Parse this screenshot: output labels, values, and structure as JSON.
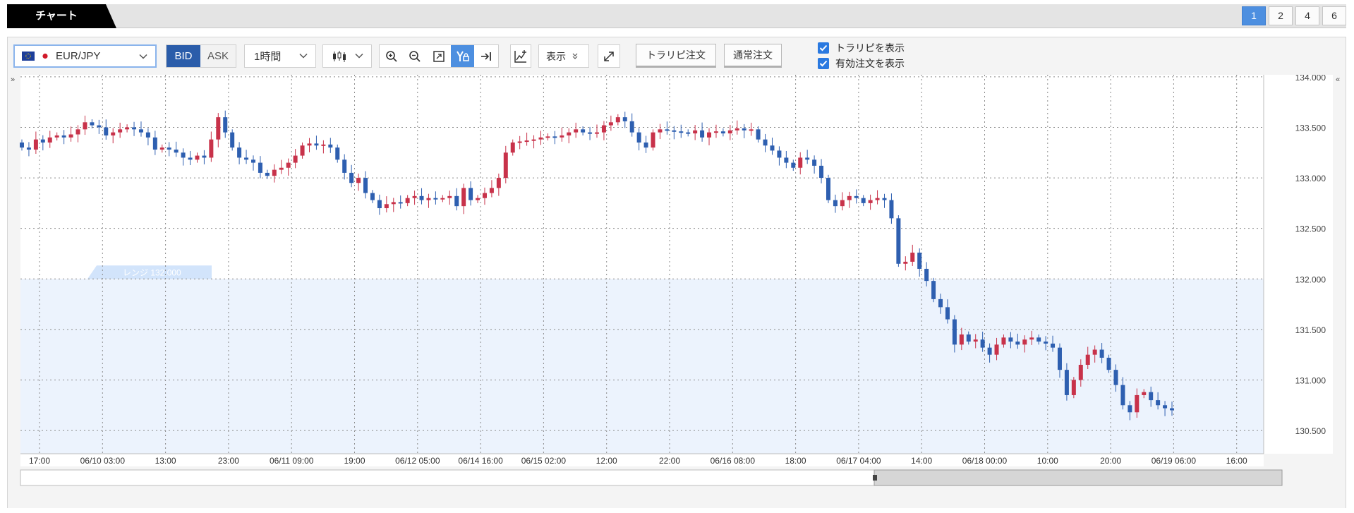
{
  "tab": {
    "label": "チャート"
  },
  "layout_buttons": [
    "1",
    "2",
    "4",
    "6"
  ],
  "toolbar": {
    "symbol": "EUR/JPY",
    "bid": "BID",
    "ask": "ASK",
    "period": "1時間",
    "display": "表示",
    "trailing_order": "トラリピ注文",
    "normal_order": "通常注文",
    "show_trailing": "トラリピを表示",
    "show_active_orders": "有効注文を表示"
  },
  "colors": {
    "up": "#c8324a",
    "down": "#2e5fb0",
    "range_fill": "#ecf3fd",
    "accent": "#4d8fe0"
  },
  "chart_data": {
    "type": "candlestick",
    "symbol": "EUR/JPY",
    "timeframe": "1時間",
    "y_ticks": [
      "134.000",
      "133.500",
      "133.000",
      "132.500",
      "132.000",
      "131.500",
      "131.000",
      "130.500"
    ],
    "ylim": [
      130.27,
      134.02
    ],
    "x_ticks": [
      "17:00",
      "06/10 03:00",
      "13:00",
      "23:00",
      "06/11 09:00",
      "19:00",
      "06/12 05:00",
      "06/14 16:00",
      "06/15 02:00",
      "12:00",
      "22:00",
      "06/16 08:00",
      "18:00",
      "06/17 04:00",
      "14:00",
      "06/18 00:00",
      "10:00",
      "20:00",
      "06/19 06:00",
      "16:00"
    ],
    "range_band": {
      "label": "レンジ 132.000",
      "from": 130.27,
      "to": 132.0
    },
    "close": [
      133.3,
      133.28,
      133.38,
      133.35,
      133.4,
      133.42,
      133.4,
      133.43,
      133.48,
      133.55,
      133.52,
      133.5,
      133.42,
      133.45,
      133.48,
      133.5,
      133.48,
      133.45,
      133.4,
      133.28,
      133.3,
      133.28,
      133.25,
      133.2,
      133.18,
      133.22,
      133.2,
      133.38,
      133.6,
      133.45,
      133.3,
      133.2,
      133.18,
      133.15,
      133.05,
      133.02,
      133.08,
      133.1,
      133.15,
      133.22,
      133.32,
      133.34,
      133.32,
      133.33,
      133.3,
      133.18,
      133.05,
      132.95,
      133.0,
      132.85,
      132.78,
      132.7,
      132.74,
      132.76,
      132.75,
      132.8,
      132.82,
      132.78,
      132.8,
      132.79,
      132.8,
      132.82,
      132.72,
      132.9,
      132.78,
      132.8,
      132.85,
      132.9,
      133.0,
      133.25,
      133.35,
      133.36,
      133.37,
      133.38,
      133.4,
      133.41,
      133.4,
      133.42,
      133.45,
      133.48,
      133.45,
      133.44,
      133.45,
      133.52,
      133.55,
      133.6,
      133.56,
      133.45,
      133.35,
      133.3,
      133.45,
      133.48,
      133.47,
      133.46,
      133.45,
      133.44,
      133.47,
      133.4,
      133.45,
      133.46,
      133.44,
      133.47,
      133.49,
      133.47,
      133.48,
      133.38,
      133.32,
      133.27,
      133.2,
      133.15,
      133.1,
      133.2,
      133.18,
      133.12,
      133.0,
      132.78,
      132.72,
      132.78,
      132.82,
      132.8,
      132.75,
      132.78,
      132.8,
      132.78,
      132.6,
      132.15,
      132.17,
      132.26,
      132.1,
      131.98,
      131.8,
      131.72,
      131.6,
      131.35,
      131.45,
      131.38,
      131.4,
      131.32,
      131.25,
      131.35,
      131.42,
      131.38,
      131.35,
      131.4,
      131.42,
      131.38,
      131.36,
      131.32,
      131.1,
      130.85,
      131.0,
      131.15,
      131.25,
      131.3,
      131.22,
      131.1,
      130.95,
      130.75,
      130.68,
      130.85,
      130.88,
      130.8,
      130.75,
      130.72,
      130.7
    ],
    "open0": 133.35
  }
}
